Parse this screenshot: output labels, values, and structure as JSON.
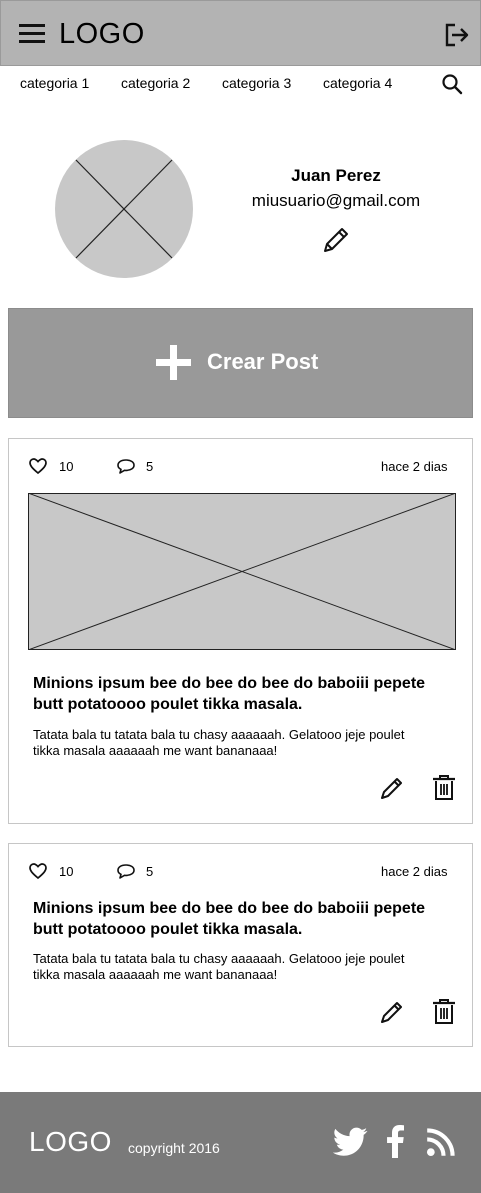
{
  "header": {
    "logo": "LOGO",
    "menu_icon": "hamburger-menu-icon",
    "logout_icon": "logout-icon"
  },
  "nav": {
    "items": [
      "categoria 1",
      "categoria 2",
      "categoria 3",
      "categoria 4"
    ],
    "search_icon": "search-icon"
  },
  "profile": {
    "name": "Juan Perez",
    "email": "miusuario@gmail.com",
    "edit_icon": "pencil-icon"
  },
  "create_post": {
    "label": "Crear Post",
    "icon": "plus-icon"
  },
  "posts": [
    {
      "likes": "10",
      "comments": "5",
      "time": "hace 2 dias",
      "has_image": true,
      "title": "Minions ipsum bee do bee do bee do baboiii pepete butt potatoooo poulet tikka masala.",
      "body": "Tatata bala tu tatata bala tu chasy aaaaaah. Gelatooo jeje poulet tikka masala aaaaaah me want bananaaa!"
    },
    {
      "likes": "10",
      "comments": "5",
      "time": "hace 2 dias",
      "has_image": false,
      "title": "Minions ipsum bee do bee do bee do baboiii pepete butt potatoooo poulet tikka masala.",
      "body": "Tatata bala tu tatata bala tu chasy aaaaaah. Gelatooo jeje poulet tikka masala aaaaaah me want bananaaa!"
    }
  ],
  "footer": {
    "logo": "LOGO",
    "copyright": "copyright 2016",
    "social_icons": [
      "twitter-icon",
      "facebook-icon",
      "rss-icon"
    ]
  },
  "colors": {
    "header_bg": "#b3b3b3",
    "button_bg": "#999999",
    "footer_bg": "#7a7a7a",
    "placeholder": "#c8c8c8"
  }
}
